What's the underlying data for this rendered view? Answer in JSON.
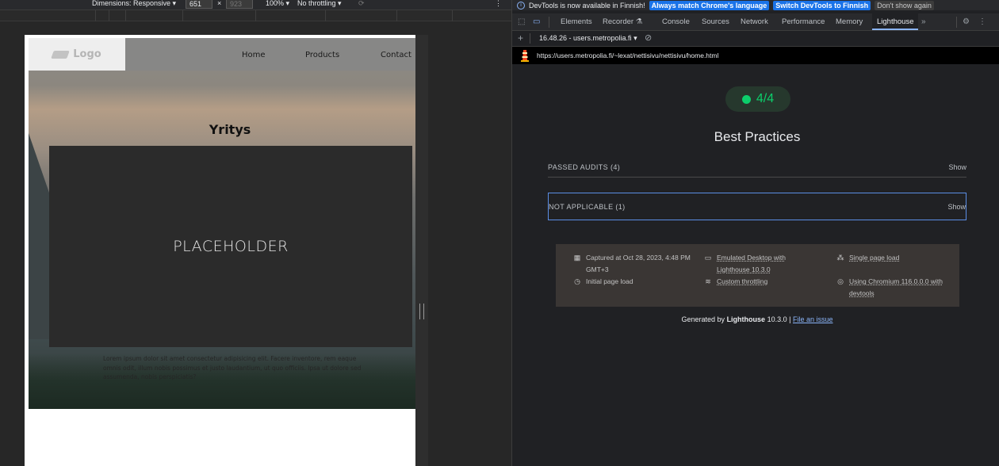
{
  "device_toolbar": {
    "dimensions_label": "Dimensions: Responsive",
    "width_value": "651",
    "times": "×",
    "height_placeholder": "923",
    "zoom": "100%",
    "throttling": "No throttling",
    "more": "⋮"
  },
  "site": {
    "logo": "Logo",
    "nav": [
      "Home",
      "Products",
      "Contact"
    ],
    "title": "Yritys",
    "placeholder": "PLACEHOLDER",
    "lorem": "Lorem ipsum dolor sit amet consectetur adipisicing elit. Facere inventore, rem eaque omnis odit, illum nobis possimus et justo laudantium, ut quo officiis. Ipsa ut dolore sed assumenda, nobis perspiciatis?"
  },
  "infobar": {
    "message": "DevTools is now available in Finnish!",
    "btn_match": "Always match Chrome's language",
    "btn_switch": "Switch DevTools to Finnish",
    "btn_dismiss": "Don't show again"
  },
  "tabs": [
    "Elements",
    "Recorder ⚗",
    "Console",
    "Sources",
    "Network",
    "Performance",
    "Memory",
    "Lighthouse"
  ],
  "active_tab": "Lighthouse",
  "subbar": {
    "report": "16.48.26 - users.metropolia.fi",
    "dropdown": "▾"
  },
  "url": "https://users.metropolia.fi/~lexat/nettisivu/nettisivu/home.html",
  "lighthouse": {
    "score": "4/4",
    "category": "Best Practices",
    "groups": [
      {
        "label": "PASSED AUDITS (4)",
        "action": "Show"
      },
      {
        "label": "NOT APPLICABLE (1)",
        "action": "Show"
      }
    ],
    "meta": {
      "captured": "Captured at Oct 28, 2023, 4:48 PM GMT+3",
      "initial": "Initial page load",
      "emulated": "Emulated Desktop with Lighthouse 10.3.0",
      "throttling": "Custom throttling",
      "single": "Single page load",
      "chromium": "Using Chromium 116.0.0.0 with devtools"
    },
    "footer": {
      "prefix": "Generated by",
      "brand": "Lighthouse",
      "version": "10.3.0 |",
      "link": "File an issue"
    }
  },
  "colors": {
    "pass": "#0cce6b",
    "link": "#8ab4f8",
    "info_button": "#1a73e8"
  }
}
